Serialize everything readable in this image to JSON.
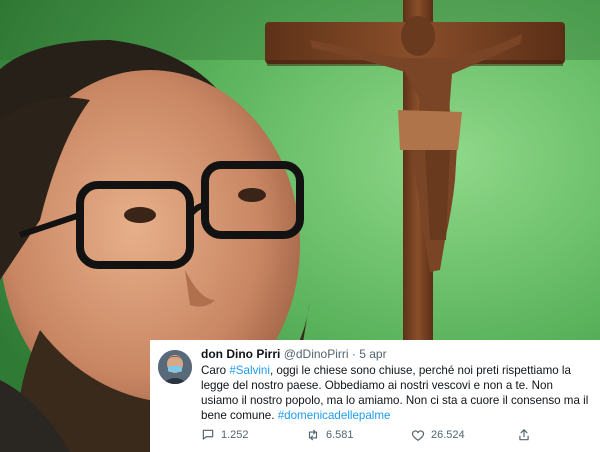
{
  "tweet": {
    "display_name": "don Dino Pirri",
    "handle": "@dDinoPirri",
    "separator": "·",
    "date": "5 apr",
    "text_parts": {
      "p1": "Caro ",
      "mention": "#Salvini",
      "p2": ", oggi le chiese sono chiuse, perché noi preti rispettiamo la legge del nostro paese.  Obbediamo ai nostri vescovi e non a te. Non usiamo il nostro popolo, ma lo amiamo. Non ci sta a cuore il consenso ma il bene comune. ",
      "hashtag": "#domenicadellepalme"
    },
    "stats": {
      "replies": "1.252",
      "retweets": "6.581",
      "likes": "26.524"
    }
  },
  "colors": {
    "background_green": "#49a24a",
    "link_blue": "#1d9bf0",
    "card_bg": "#ffffff"
  },
  "icons": {
    "reply": "comment-icon",
    "retweet": "retweet-icon",
    "like": "heart-icon",
    "share": "share-icon"
  }
}
